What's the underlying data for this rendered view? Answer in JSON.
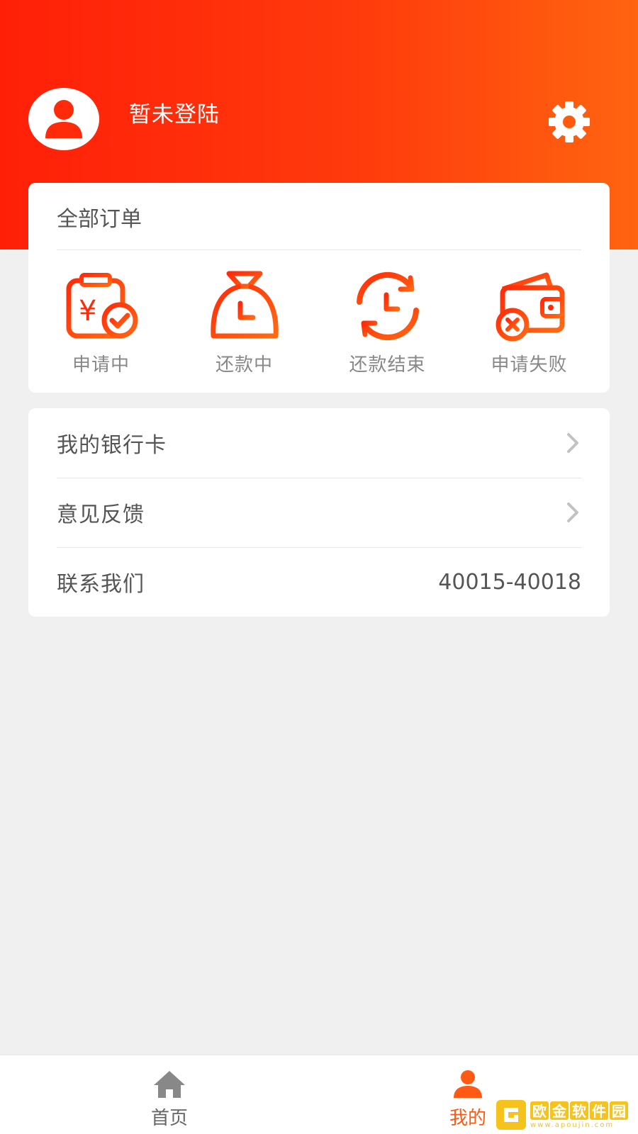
{
  "header": {
    "user_name": "暂未登陆",
    "avatar_icon": "user-avatar-icon",
    "settings_icon": "gear-icon"
  },
  "orders": {
    "title": "全部订单",
    "items": [
      {
        "label": "申请中",
        "icon": "application-pending-icon"
      },
      {
        "label": "还款中",
        "icon": "money-bag-clock-icon"
      },
      {
        "label": "还款结束",
        "icon": "clock-cycle-icon"
      },
      {
        "label": "申请失败",
        "icon": "wallet-failed-icon"
      }
    ]
  },
  "menu": {
    "items": [
      {
        "label": "我的银行卡",
        "icon": "chevron-right-icon"
      },
      {
        "label": "意见反馈",
        "icon": "chevron-right-icon"
      },
      {
        "label": "联系我们",
        "value": "40015-40018"
      }
    ]
  },
  "bottom_nav": {
    "items": [
      {
        "label": "首页",
        "icon": "home-icon",
        "active": false
      },
      {
        "label": "我的",
        "icon": "user-icon",
        "active": true
      }
    ]
  },
  "watermark": {
    "title": "欧金软件园",
    "subtitle": "www.apoujin.com"
  },
  "colors": {
    "accent": "#ff3a0c",
    "accent_gradient_start": "#ff1f08",
    "accent_gradient_end": "#ff6410",
    "nav_inactive": "#888888"
  }
}
